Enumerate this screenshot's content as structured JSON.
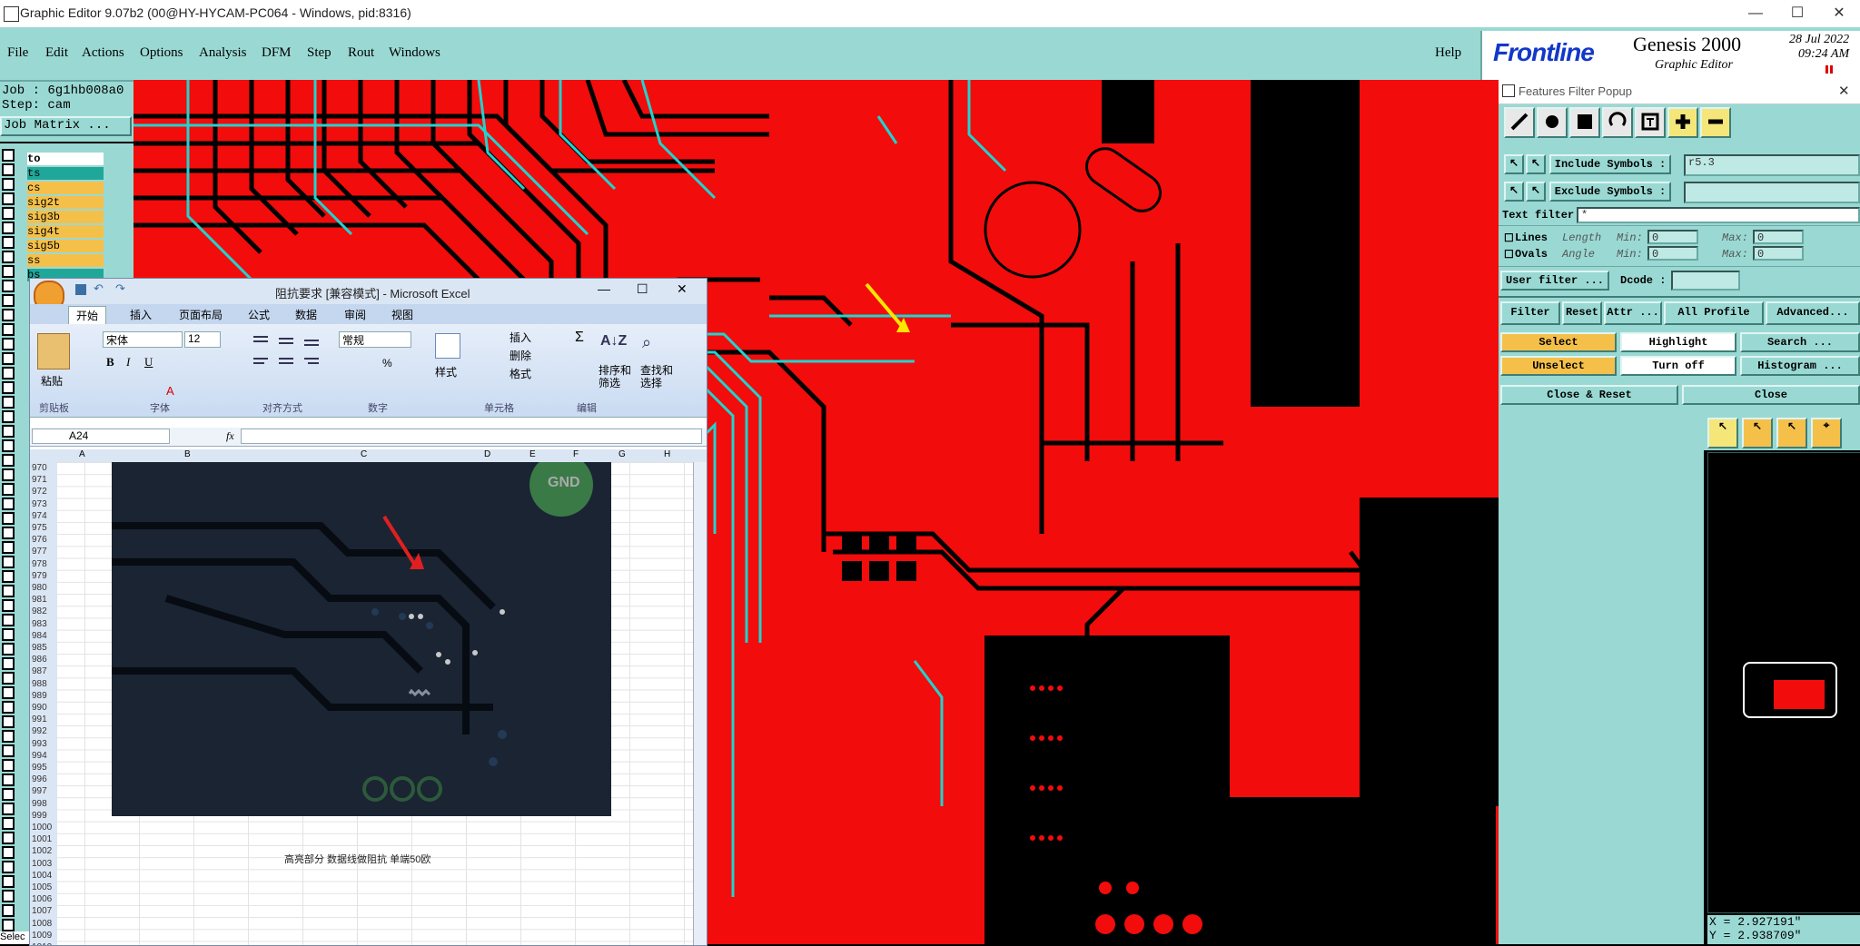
{
  "window": {
    "title": "Graphic Editor 9.07b2 (00@HY-HYCAM-PC064 - Windows, pid:8316)"
  },
  "menu": [
    "File",
    "Edit",
    "Actions",
    "Options",
    "Analysis",
    "DFM",
    "Step",
    "Rout",
    "Windows"
  ],
  "help_label": "Help",
  "logo": {
    "brand": "Frontline",
    "product": "Genesis 2000",
    "subtitle": "Graphic Editor",
    "date": "28 Jul 2022",
    "time": "09:24 AM"
  },
  "job": {
    "job_line": "Job : 6g1hb008a0",
    "step_line": "Step: cam",
    "matrix_button": "Job Matrix ..."
  },
  "layers": [
    "to",
    "ts",
    "cs",
    "sig2t",
    "sig3b",
    "sig4t",
    "sig5b",
    "ss",
    "bs"
  ],
  "popup": {
    "title": "Features Filter Popup",
    "include_label": "Include Symbols :",
    "include_value": "r5.3",
    "exclude_label": "Exclude Symbols :",
    "text_filter_label": "Text filter",
    "text_filter_value": "*",
    "lines_label": "Lines",
    "ovals_label": "Ovals",
    "length_label": "Length",
    "angle_label": "Angle",
    "min_label": "Min:",
    "max_label": "Max:",
    "length_min": "0",
    "length_max": "0",
    "angle_min": "0",
    "angle_max": "0",
    "user_filter": "User filter ...",
    "dcode": "Dcode :",
    "filter": "Filter",
    "reset": "Reset",
    "attr": "Attr ...",
    "all_profile": "All Profile",
    "advanced": "Advanced...",
    "select": "Select",
    "highlight": "Highlight",
    "search": "Search ...",
    "unselect": "Unselect",
    "turn_off": "Turn off",
    "histogram": "Histogram ...",
    "close_reset": "Close & Reset",
    "close": "Close"
  },
  "coords": {
    "x": "X = 2.927191\"",
    "y": "Y = 2.938709\""
  },
  "status_left": "Selec",
  "excel": {
    "title": "阻抗要求 [兼容模式] - Microsoft Excel",
    "tabs": [
      "开始",
      "插入",
      "页面布局",
      "公式",
      "数据",
      "审阅",
      "视图"
    ],
    "font": "宋体",
    "size": "12",
    "number_format": "常规",
    "groups": [
      "剪贴板",
      "字体",
      "对齐方式",
      "数字",
      "单元格",
      "编辑"
    ],
    "paste": "粘贴",
    "style": "样式",
    "insert": "插入",
    "delete": "删除",
    "format": "格式",
    "sort": "排序和\n筛选",
    "find": "查找和\n选择",
    "namebox": "A24",
    "fx": "fx",
    "columns": [
      "A",
      "B",
      "C",
      "D",
      "E",
      "F",
      "G",
      "H"
    ],
    "rows": [
      "970",
      "971",
      "972",
      "973",
      "974",
      "975",
      "976",
      "977",
      "978",
      "979",
      "980",
      "981",
      "982",
      "983",
      "984",
      "985",
      "986",
      "987",
      "988",
      "989",
      "990",
      "991",
      "992",
      "993",
      "994",
      "995",
      "996",
      "997",
      "998",
      "999",
      "1000",
      "1001",
      "1002",
      "1003",
      "1004",
      "1005",
      "1006",
      "1007",
      "1008",
      "1009",
      "1010"
    ],
    "note": "高亮部分  数据线做阻抗 单端50欧",
    "image_label": "GND"
  },
  "colors": {
    "accent": "#9ad9d3",
    "canvas": "#f20c0c",
    "trace": "#1fd4cf"
  }
}
